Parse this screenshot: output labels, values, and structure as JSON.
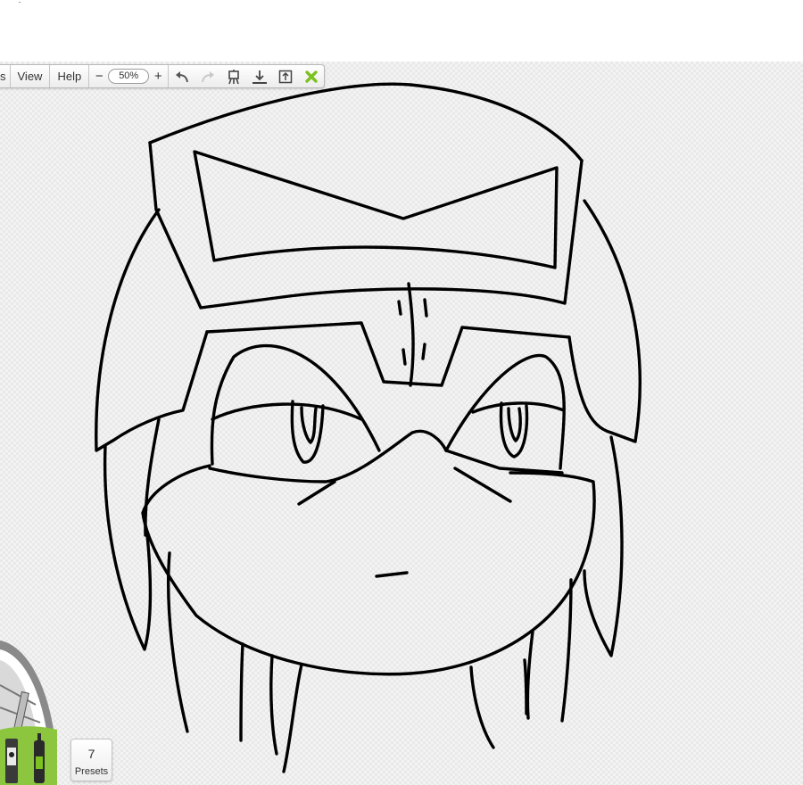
{
  "toolbar": {
    "menu": [
      {
        "label": "s"
      },
      {
        "label": "View"
      },
      {
        "label": "Help"
      }
    ],
    "zoom": {
      "minus": "−",
      "value": "50%",
      "plus": "+"
    },
    "icons": [
      "undo-icon",
      "redo-icon",
      "easel-icon",
      "download-icon",
      "upload-icon",
      "close-icon"
    ],
    "accent_color": "#7dc11f"
  },
  "presets": {
    "count": "7",
    "label": "Presets"
  },
  "brush_wheel": {
    "icons": [
      "pencil-brush-icon",
      "marker-brush-icon",
      "paint-tube-icon"
    ]
  }
}
